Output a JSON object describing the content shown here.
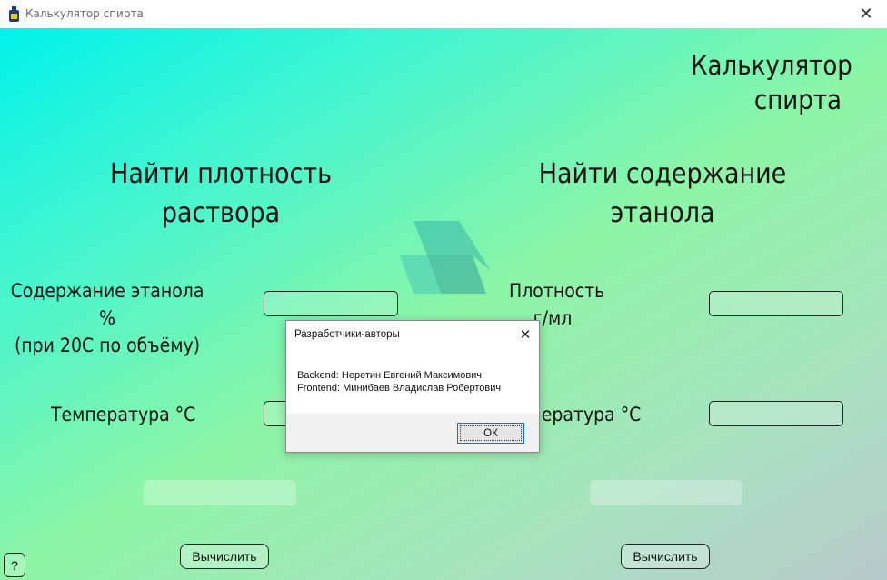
{
  "window": {
    "title": "Калькулятор спирта",
    "close_symbol": "✕",
    "icon": "bottle-icon"
  },
  "header": {
    "app_title_line1": "Калькулятор",
    "app_title_line2": "спирта"
  },
  "left_section": {
    "title_line1": "Найти плотность",
    "title_line2": "раствора",
    "ethanol_label_line1": "Содержание этанола %",
    "ethanol_label_line2": "(при 20С по объёму)",
    "temperature_label": "Температура °С",
    "ethanol_value": "",
    "temperature_value": "",
    "result_text": "",
    "calculate_label": "Вычислить"
  },
  "right_section": {
    "title_line1": "Найти содержание",
    "title_line2": "этанола",
    "density_label_line1": "Плотность",
    "density_label_line2": "г/мл",
    "temperature_label": "Температура °С",
    "density_value": "",
    "temperature_value": "",
    "result_text": "",
    "calculate_label": "Вычислить"
  },
  "help_button": {
    "label": "?"
  },
  "dialog": {
    "title": "Разработчики-авторы",
    "close_symbol": "✕",
    "line1": "Backend: Неретин Евгений Максимович",
    "line2": "Frontend: Минибаев Владислав Робертович",
    "ok_label": "ОК"
  },
  "colors": {
    "gradient_start": "#00f2ea",
    "gradient_mid": "#8ef5a6",
    "gradient_end": "#b8c9c9",
    "dialog_accent": "#0078d7"
  }
}
